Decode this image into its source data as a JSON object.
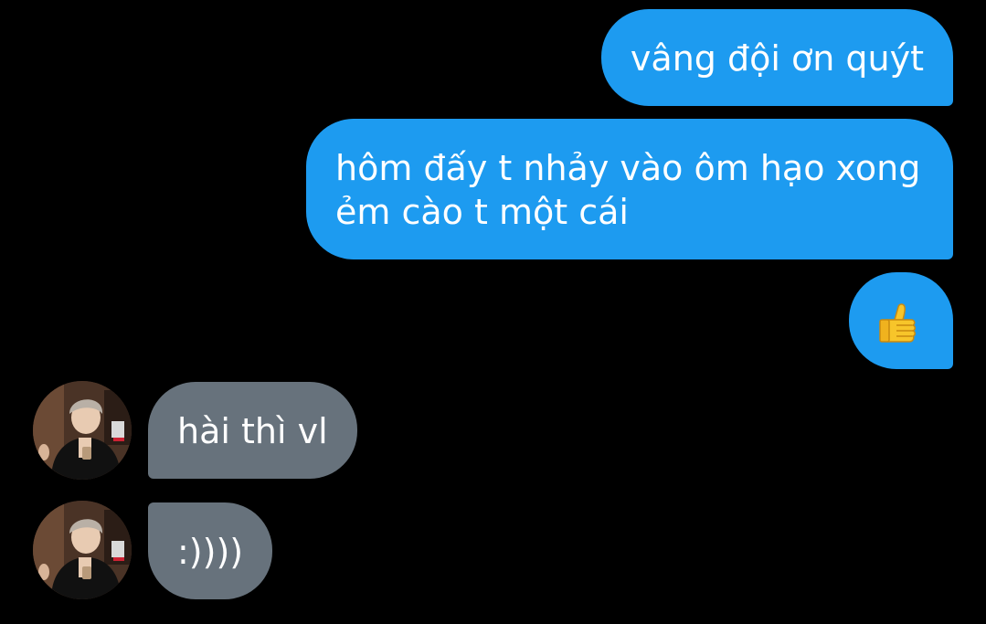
{
  "messages": [
    {
      "direction": "outgoing",
      "text": "vâng đội ơn quýt"
    },
    {
      "direction": "outgoing",
      "lines": [
        "hôm đấy t nhảy vào ôm hạo xong",
        "ẻm cào t một cái"
      ]
    },
    {
      "direction": "outgoing",
      "emoji": "thumbs-up"
    },
    {
      "direction": "incoming",
      "text": "hài thì vl",
      "avatar": "contact-avatar"
    },
    {
      "direction": "incoming",
      "text": ":))))",
      "avatar": "contact-avatar"
    }
  ],
  "colors": {
    "background": "#000000",
    "outgoing_bubble": "#1d9bf0",
    "incoming_bubble": "#67727c",
    "text": "#ffffff",
    "emoji": "#f7c52a"
  }
}
